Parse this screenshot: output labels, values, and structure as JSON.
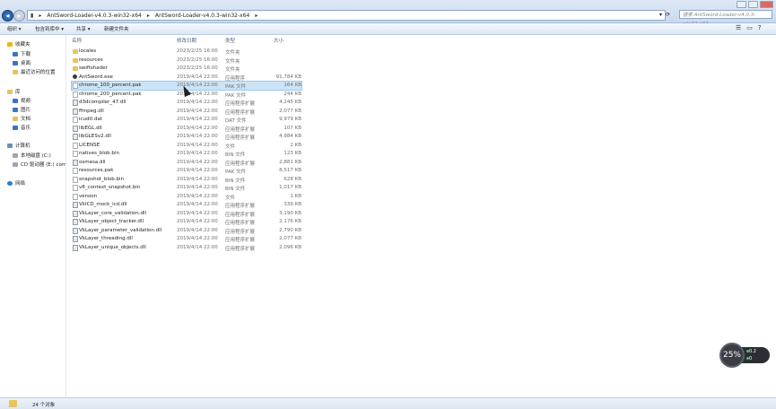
{
  "address": {
    "segments": [
      "AntSword-Loader-v4.0.3-win32-x64",
      "AntSword-Loader-v4.0.3-win32-x64"
    ],
    "separator": "▸",
    "search_placeholder": "搜索 AntSword-Loader-v4.0.3-win32-x64"
  },
  "toolbar": {
    "organize": "组织 ▾",
    "include_in_library": "包含到库中 ▾",
    "share": "共享 ▾",
    "new_folder": "新建文件夹"
  },
  "sidebar": {
    "favorites": {
      "label": "收藏夹",
      "items": [
        "下载",
        "桌面",
        "最近访问的位置"
      ]
    },
    "libraries": {
      "label": "库",
      "items": [
        "视频",
        "图片",
        "文档",
        "音乐"
      ]
    },
    "computer": {
      "label": "计算机",
      "items": [
        "本地磁盘 (C:)",
        "CD 驱动器 (E:) corr"
      ]
    },
    "network": {
      "label": "网络"
    }
  },
  "columns": {
    "name": "名称",
    "date": "修改日期",
    "type": "类型",
    "size": "大小"
  },
  "files": [
    {
      "name": "locales",
      "date": "2023/2/25 16:00",
      "type": "文件夹",
      "size": "",
      "kind": "folder"
    },
    {
      "name": "resources",
      "date": "2023/2/25 16:00",
      "type": "文件夹",
      "size": "",
      "kind": "folder"
    },
    {
      "name": "swiftshader",
      "date": "2023/2/25 16:00",
      "type": "文件夹",
      "size": "",
      "kind": "folder"
    },
    {
      "name": "AntSword.exe",
      "date": "2019/4/14 22:00",
      "type": "应用程序",
      "size": "91,784 KB",
      "kind": "exe"
    },
    {
      "name": "chrome_100_percent.pak",
      "date": "2019/4/14 22:00",
      "type": "PAK 文件",
      "size": "164 KB",
      "kind": "file"
    },
    {
      "name": "chrome_200_percent.pak",
      "date": "2019/4/14 22:00",
      "type": "PAK 文件",
      "size": "244 KB",
      "kind": "file"
    },
    {
      "name": "d3dcompiler_47.dll",
      "date": "2019/4/14 22:00",
      "type": "应用程序扩展",
      "size": "4,245 KB",
      "kind": "dll"
    },
    {
      "name": "ffmpeg.dll",
      "date": "2019/4/14 22:00",
      "type": "应用程序扩展",
      "size": "2,077 KB",
      "kind": "dll"
    },
    {
      "name": "icudtl.dat",
      "date": "2019/4/14 22:00",
      "type": "DAT 文件",
      "size": "9,979 KB",
      "kind": "file"
    },
    {
      "name": "libEGL.dll",
      "date": "2019/4/14 22:00",
      "type": "应用程序扩展",
      "size": "107 KB",
      "kind": "dll"
    },
    {
      "name": "libGLESv2.dll",
      "date": "2019/4/14 22:00",
      "type": "应用程序扩展",
      "size": "4,984 KB",
      "kind": "dll"
    },
    {
      "name": "LICENSE",
      "date": "2019/4/14 22:00",
      "type": "文件",
      "size": "2 KB",
      "kind": "file"
    },
    {
      "name": "natives_blob.bin",
      "date": "2019/4/14 22:00",
      "type": "BIN 文件",
      "size": "123 KB",
      "kind": "file"
    },
    {
      "name": "osmesa.dll",
      "date": "2019/4/14 22:00",
      "type": "应用程序扩展",
      "size": "2,881 KB",
      "kind": "dll"
    },
    {
      "name": "resources.pak",
      "date": "2019/4/14 22:00",
      "type": "PAK 文件",
      "size": "8,517 KB",
      "kind": "file"
    },
    {
      "name": "snapshot_blob.bin",
      "date": "2019/4/14 22:00",
      "type": "BIN 文件",
      "size": "628 KB",
      "kind": "file"
    },
    {
      "name": "v8_context_snapshot.bin",
      "date": "2019/4/14 22:00",
      "type": "BIN 文件",
      "size": "1,017 KB",
      "kind": "file"
    },
    {
      "name": "version",
      "date": "2019/4/14 22:00",
      "type": "文件",
      "size": "1 KB",
      "kind": "file"
    },
    {
      "name": "VkICD_mock_icd.dll",
      "date": "2019/4/14 22:00",
      "type": "应用程序扩展",
      "size": "339 KB",
      "kind": "dll"
    },
    {
      "name": "VkLayer_core_validation.dll",
      "date": "2019/4/14 22:00",
      "type": "应用程序扩展",
      "size": "3,190 KB",
      "kind": "dll"
    },
    {
      "name": "VkLayer_object_tracker.dll",
      "date": "2019/4/14 22:00",
      "type": "应用程序扩展",
      "size": "2,176 KB",
      "kind": "dll"
    },
    {
      "name": "VkLayer_parameter_validation.dll",
      "date": "2019/4/14 22:00",
      "type": "应用程序扩展",
      "size": "2,790 KB",
      "kind": "dll"
    },
    {
      "name": "VkLayer_threading.dll",
      "date": "2019/4/14 22:00",
      "type": "应用程序扩展",
      "size": "2,077 KB",
      "kind": "dll"
    },
    {
      "name": "VkLayer_unique_objects.dll",
      "date": "2019/4/14 22:00",
      "type": "应用程序扩展",
      "size": "2,096 KB",
      "kind": "dll"
    }
  ],
  "selected_index": 4,
  "status": {
    "count_text": "24 个对象"
  },
  "widget": {
    "percent": "25%",
    "upload": "0.2",
    "download": "0"
  },
  "colors": {
    "selection": "#cce4f7",
    "accent": "#3b73c4"
  }
}
